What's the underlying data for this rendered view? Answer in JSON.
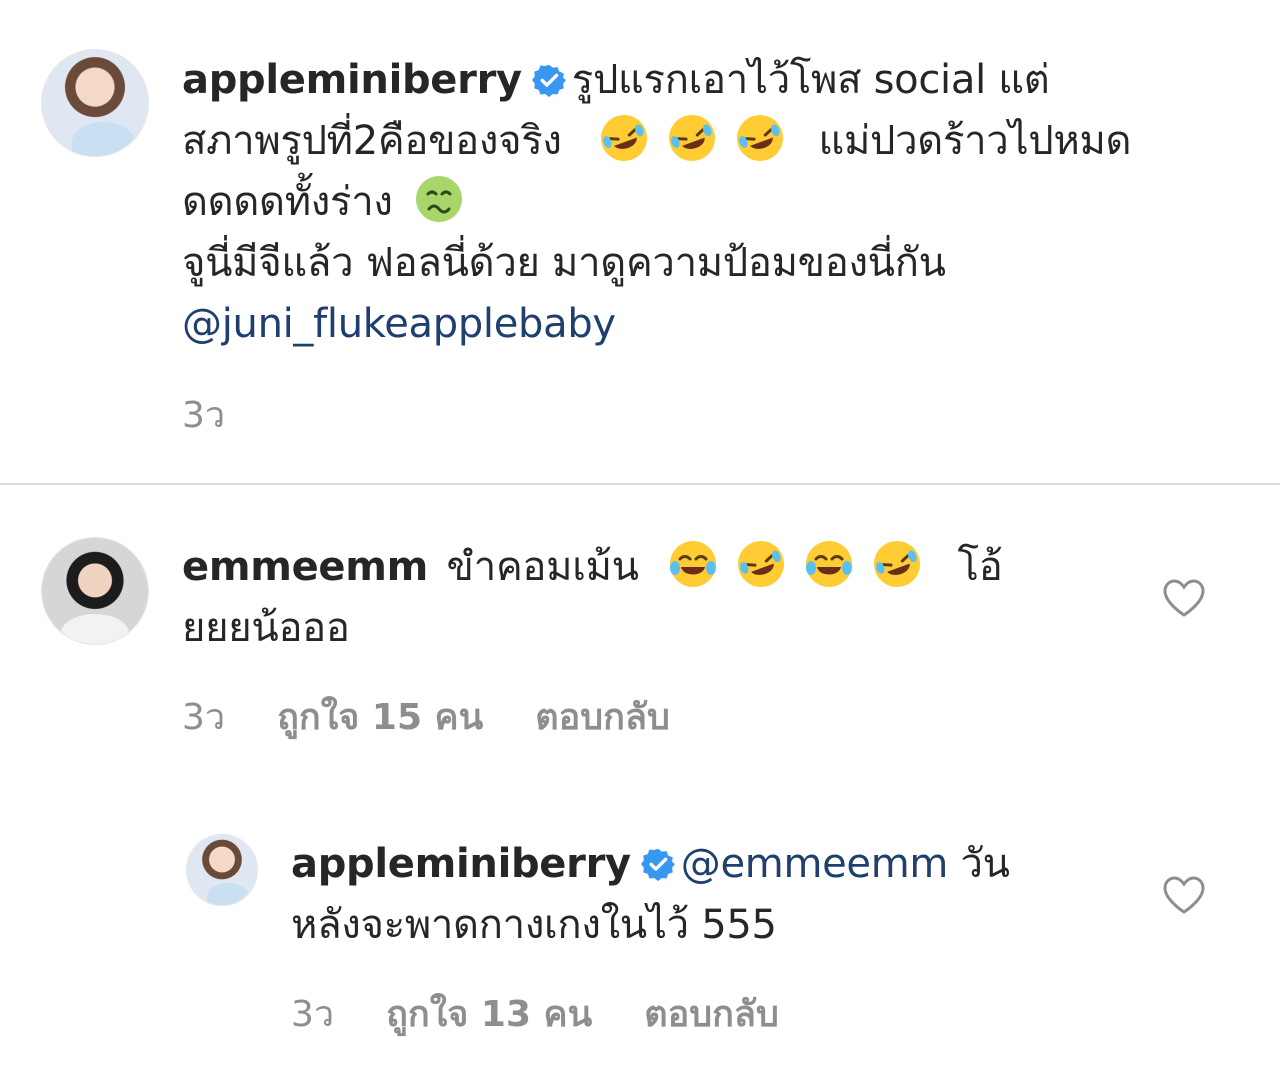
{
  "caption": {
    "username": "appleminiberry",
    "line1": "รูปแรกเอาไว้โพส social แต่",
    "line2a": "สภาพรูปที่2คือของจริง",
    "line2b": "แม่ปวดร้าวไปหมด",
    "line3": "ดดดดทั้งร่าง",
    "line4": "จูนี่มีจีแล้ว ฟอลนี่ด้วย มาดูความป้อมของนี่กัน",
    "mention": "@juni_flukeapplebaby",
    "time": "3ว"
  },
  "comment1": {
    "username": "emmeemm",
    "text_a": "ขำคอมเม้น",
    "text_b": "โอ้",
    "line2": "ยยยน้อออ",
    "time": "3ว",
    "likes": "ถูกใจ 15 คน",
    "reply": "ตอบกลับ"
  },
  "reply1": {
    "username": "appleminiberry",
    "mention": "@emmeemm",
    "text_a": "วัน",
    "line2": "หลังจะพาดกางเกงในไว้ 555",
    "time": "3ว",
    "likes": "ถูกใจ 13 คน",
    "reply": "ตอบกลับ"
  },
  "colors": {
    "verified": "#3897f0",
    "mention": "#1f3f6e",
    "muted": "#8e8e8e",
    "emoji_face": "#ffcc33"
  },
  "icons": [
    "verified-badge-icon",
    "rofl-emoji-icon",
    "joy-emoji-icon",
    "nauseated-emoji-icon",
    "heart-outline-icon"
  ]
}
